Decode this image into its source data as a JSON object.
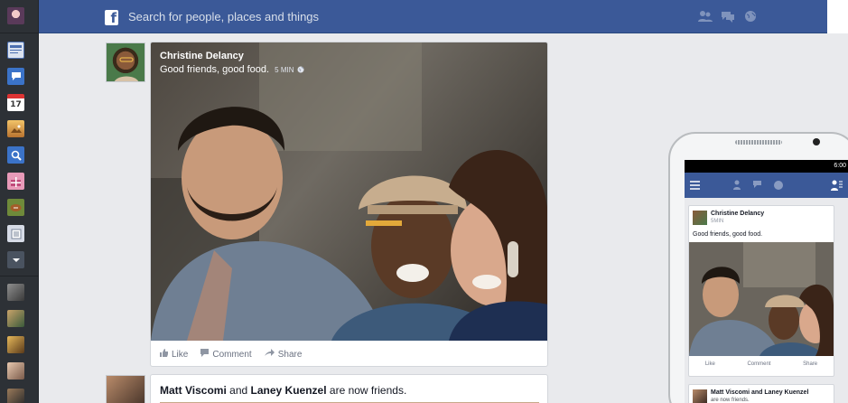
{
  "topbar": {
    "logo_letter": "f",
    "search_placeholder": "Search for people, places and things",
    "icons": [
      "friend-requests-icon",
      "messages-icon",
      "notifications-globe-icon"
    ]
  },
  "sidebar": {
    "apps": [
      {
        "name": "news-feed-icon",
        "color": "#4c6fb0"
      },
      {
        "name": "messages-icon",
        "color": "#3b73c8"
      },
      {
        "name": "events-calendar-icon",
        "color": "#ffffff",
        "text": "17"
      },
      {
        "name": "photos-icon",
        "color": "#d08a3a"
      },
      {
        "name": "search-icon",
        "color": "#3b73c8"
      },
      {
        "name": "gifts-icon",
        "color": "#c04a7a"
      },
      {
        "name": "games-icon",
        "color": "#6f8a3a"
      },
      {
        "name": "notes-icon",
        "color": "#d6dbe6"
      },
      {
        "name": "more-dropdown-icon",
        "color": "#4a5360"
      }
    ]
  },
  "feed": {
    "post": {
      "author": "Christine Delancy",
      "message": "Good friends, good food.",
      "time": "5 MIN",
      "actions": {
        "like": "Like",
        "comment": "Comment",
        "share": "Share"
      }
    },
    "story2": {
      "name_a": "Matt Viscomi",
      "connector": "and",
      "name_b": "Laney Kuenzel",
      "suffix": "are now friends."
    }
  },
  "phone": {
    "status_time": "6:00",
    "post": {
      "author": "Christine Delancy",
      "time": "5MIN",
      "message": "Good friends, good food.",
      "actions": {
        "like": "Like",
        "comment": "Comment",
        "share": "Share"
      }
    },
    "story2": {
      "text": "Matt Viscomi and Laney Kuenzel",
      "suffix": "are now friends."
    }
  },
  "colors": {
    "brand": "#3b5998",
    "rail": "#2d3136",
    "feed_bg": "#e9eaed"
  }
}
